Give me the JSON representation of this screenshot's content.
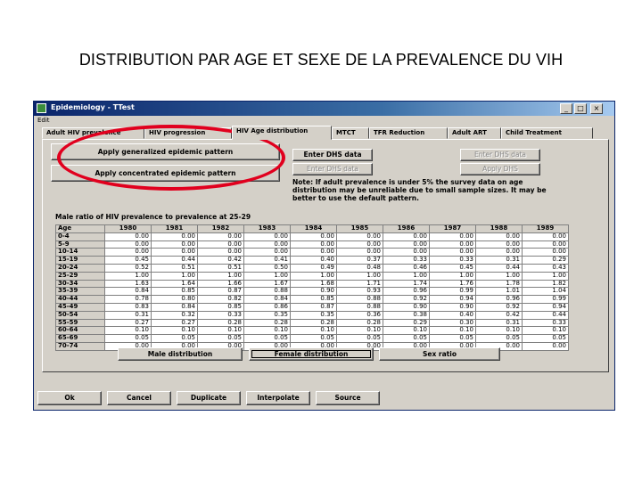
{
  "slide_title": "DISTRIBUTION PAR AGE ET SEXE DE LA PREVALENCE DU VIH",
  "window": {
    "title": "Epidemiology - TTest",
    "menu": "Edit",
    "minimize": "_",
    "maximize": "□",
    "close": "×"
  },
  "tabs": [
    "Adult HIV prevalence",
    "HIV progression",
    "HIV Age distribution",
    "MTCT",
    "TFR Reduction",
    "Adult ART",
    "Child Treatment"
  ],
  "buttons": {
    "apply_generalized": "Apply generalized epidemic pattern",
    "apply_concentrated": "Apply concentrated epidemic pattern",
    "enter_dhs_1": "Enter DHS data",
    "enter_dhs_2": "Enter DHS data",
    "enter_dhs_3": "Enter DHS data",
    "apply_dhs": "Apply DHS",
    "male_distribution": "Male distribution",
    "female_distribution": "Female distribution",
    "sex_ratio": "Sex ratio",
    "ok": "Ok",
    "cancel": "Cancel",
    "duplicate": "Duplicate",
    "interpolate": "Interpolate",
    "source": "Source"
  },
  "note": "Note: If adult prevalence is under 5% the survey data on age distribution may be unreliable due to small sample sizes. It may be better to use the default pattern.",
  "table_title": "Male ratio of HIV prevalence to prevalence at 25-29",
  "table": {
    "age_header": "Age",
    "years": [
      "1980",
      "1981",
      "1982",
      "1983",
      "1984",
      "1985",
      "1986",
      "1987",
      "1988",
      "1989"
    ],
    "rows": [
      {
        "age": "0-4",
        "values": [
          "0.00",
          "0.00",
          "0.00",
          "0.00",
          "0.00",
          "0.00",
          "0.00",
          "0.00",
          "0.00",
          "0.00"
        ]
      },
      {
        "age": "5-9",
        "values": [
          "0.00",
          "0.00",
          "0.00",
          "0.00",
          "0.00",
          "0.00",
          "0.00",
          "0.00",
          "0.00",
          "0.00"
        ]
      },
      {
        "age": "10-14",
        "values": [
          "0.00",
          "0.00",
          "0.00",
          "0.00",
          "0.00",
          "0.00",
          "0.00",
          "0.00",
          "0.00",
          "0.00"
        ]
      },
      {
        "age": "15-19",
        "values": [
          "0.45",
          "0.44",
          "0.42",
          "0.41",
          "0.40",
          "0.37",
          "0.33",
          "0.33",
          "0.31",
          "0.29"
        ]
      },
      {
        "age": "20-24",
        "values": [
          "0.52",
          "0.51",
          "0.51",
          "0.50",
          "0.49",
          "0.48",
          "0.46",
          "0.45",
          "0.44",
          "0.43"
        ]
      },
      {
        "age": "25-29",
        "values": [
          "1.00",
          "1.00",
          "1.00",
          "1.00",
          "1.00",
          "1.00",
          "1.00",
          "1.00",
          "1.00",
          "1.00"
        ]
      },
      {
        "age": "30-34",
        "values": [
          "1.63",
          "1.64",
          "1.66",
          "1.67",
          "1.68",
          "1.71",
          "1.74",
          "1.76",
          "1.78",
          "1.82"
        ]
      },
      {
        "age": "35-39",
        "values": [
          "0.84",
          "0.85",
          "0.87",
          "0.88",
          "0.90",
          "0.93",
          "0.96",
          "0.99",
          "1.01",
          "1.04"
        ]
      },
      {
        "age": "40-44",
        "values": [
          "0.78",
          "0.80",
          "0.82",
          "0.84",
          "0.85",
          "0.88",
          "0.92",
          "0.94",
          "0.96",
          "0.99"
        ]
      },
      {
        "age": "45-49",
        "values": [
          "0.83",
          "0.84",
          "0.85",
          "0.86",
          "0.87",
          "0.88",
          "0.90",
          "0.90",
          "0.92",
          "0.94"
        ]
      },
      {
        "age": "50-54",
        "values": [
          "0.31",
          "0.32",
          "0.33",
          "0.35",
          "0.35",
          "0.36",
          "0.38",
          "0.40",
          "0.42",
          "0.44"
        ]
      },
      {
        "age": "55-59",
        "values": [
          "0.27",
          "0.27",
          "0.28",
          "0.28",
          "0.28",
          "0.28",
          "0.29",
          "0.30",
          "0.31",
          "0.33"
        ]
      },
      {
        "age": "60-64",
        "values": [
          "0.10",
          "0.10",
          "0.10",
          "0.10",
          "0.10",
          "0.10",
          "0.10",
          "0.10",
          "0.10",
          "0.10"
        ]
      },
      {
        "age": "65-69",
        "values": [
          "0.05",
          "0.05",
          "0.05",
          "0.05",
          "0.05",
          "0.05",
          "0.05",
          "0.05",
          "0.05",
          "0.05"
        ]
      },
      {
        "age": "70-74",
        "values": [
          "0.00",
          "0.00",
          "0.00",
          "0.00",
          "0.00",
          "0.00",
          "0.00",
          "0.00",
          "0.00",
          "0.00"
        ]
      }
    ]
  },
  "colors": {
    "highlight_circle": "#e1001e",
    "titlebar": "#0a246a",
    "dialog_face": "#d4d0c8"
  },
  "icons": {
    "window": "app-icon",
    "highlight": "red-ellipse-annotation"
  }
}
